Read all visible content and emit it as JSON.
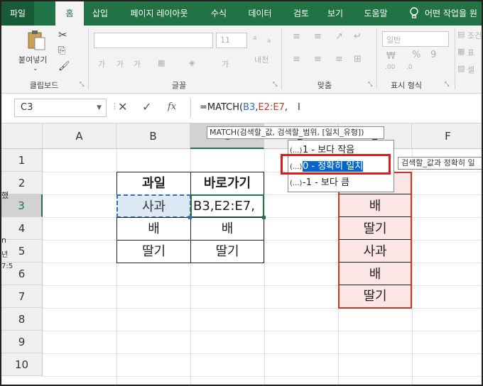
{
  "ribbon_tabs": [
    {
      "label": "파일"
    },
    {
      "label": "홈"
    },
    {
      "label": "삽입"
    },
    {
      "label": "페이지 레이아웃"
    },
    {
      "label": "수식"
    },
    {
      "label": "데이터"
    },
    {
      "label": "검토"
    },
    {
      "label": "보기"
    },
    {
      "label": "도움말"
    }
  ],
  "tell_me": "어떤 작업을 원",
  "clipboard": {
    "paste_label": "붙여넣기",
    "group_label": "클립보드"
  },
  "font_group": {
    "font_size": "11",
    "group_label": "글꼴",
    "phonetic": "내천",
    "ga1": "가",
    "ga2": "가"
  },
  "align_group": {
    "group_label": "맞춤"
  },
  "number_group": {
    "format": "일반",
    "group_label": "표시 형식",
    "percent": "%",
    "comma": "9"
  },
  "styles_group": {
    "item1": "조건",
    "item2": "표",
    "item3": "셀"
  },
  "formula_bar": {
    "name_box": "C3",
    "fx": "fx",
    "formula_prefix": "=MATCH(",
    "arg1": "B3",
    "comma": ",",
    "arg2": "E2:E7",
    "suffix": ","
  },
  "tooltip": "MATCH(검색할_값, 검색할_범위, [일치_유형])",
  "autocomplete": [
    {
      "icon": "(...)",
      "label": "1 - 보다 작음"
    },
    {
      "icon": "(...)",
      "label": "0 - 정확히 일치"
    },
    {
      "icon": "(...)",
      "label": "-1 - 보다 큼"
    }
  ],
  "autocomplete_desc": "검색할_값과 정확히 일",
  "columns": [
    "A",
    "B",
    "C",
    "D",
    "E",
    "F"
  ],
  "rows": [
    "1",
    "2",
    "3",
    "4",
    "5",
    "6",
    "7",
    "8",
    "9",
    "10"
  ],
  "table": {
    "header_b": "과일",
    "header_c": "바로가기",
    "b": [
      "사과",
      "배",
      "딸기"
    ],
    "c": [
      "B3,E2:E7,",
      "배",
      "딸기"
    ]
  },
  "list_e": [
    "배",
    "딸기",
    "사과",
    "배",
    "딸기"
  ],
  "left_clip": {
    "a": "했",
    "b": "n",
    "c": "년",
    "d": "7:5"
  },
  "colors": {
    "excel_green": "#217346",
    "highlight_red": "#e0191c",
    "selection_blue": "#0066cc",
    "pink_fill": "#fbe5e5"
  }
}
